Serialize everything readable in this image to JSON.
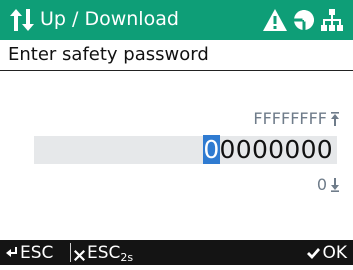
{
  "header": {
    "title": "Up / Download",
    "icons": [
      "up-down-arrows-icon",
      "warning-icon",
      "compass-circle-icon",
      "network-icon"
    ]
  },
  "prompt": {
    "label": "Enter safety password"
  },
  "password": {
    "max_value": "FFFFFFFF",
    "min_value": "0",
    "cursor_char": "0",
    "rest_chars": "0000000"
  },
  "softkeys": {
    "esc_label": "ESC",
    "esc2_label": "ESC",
    "esc2_sub": "2s",
    "ok_label": "OK"
  },
  "colors": {
    "header_bg": "#0e9e77",
    "softkey_bg": "#141414",
    "cursor_bg": "#2f7bd1",
    "entry_bg": "#e6e8ea"
  }
}
